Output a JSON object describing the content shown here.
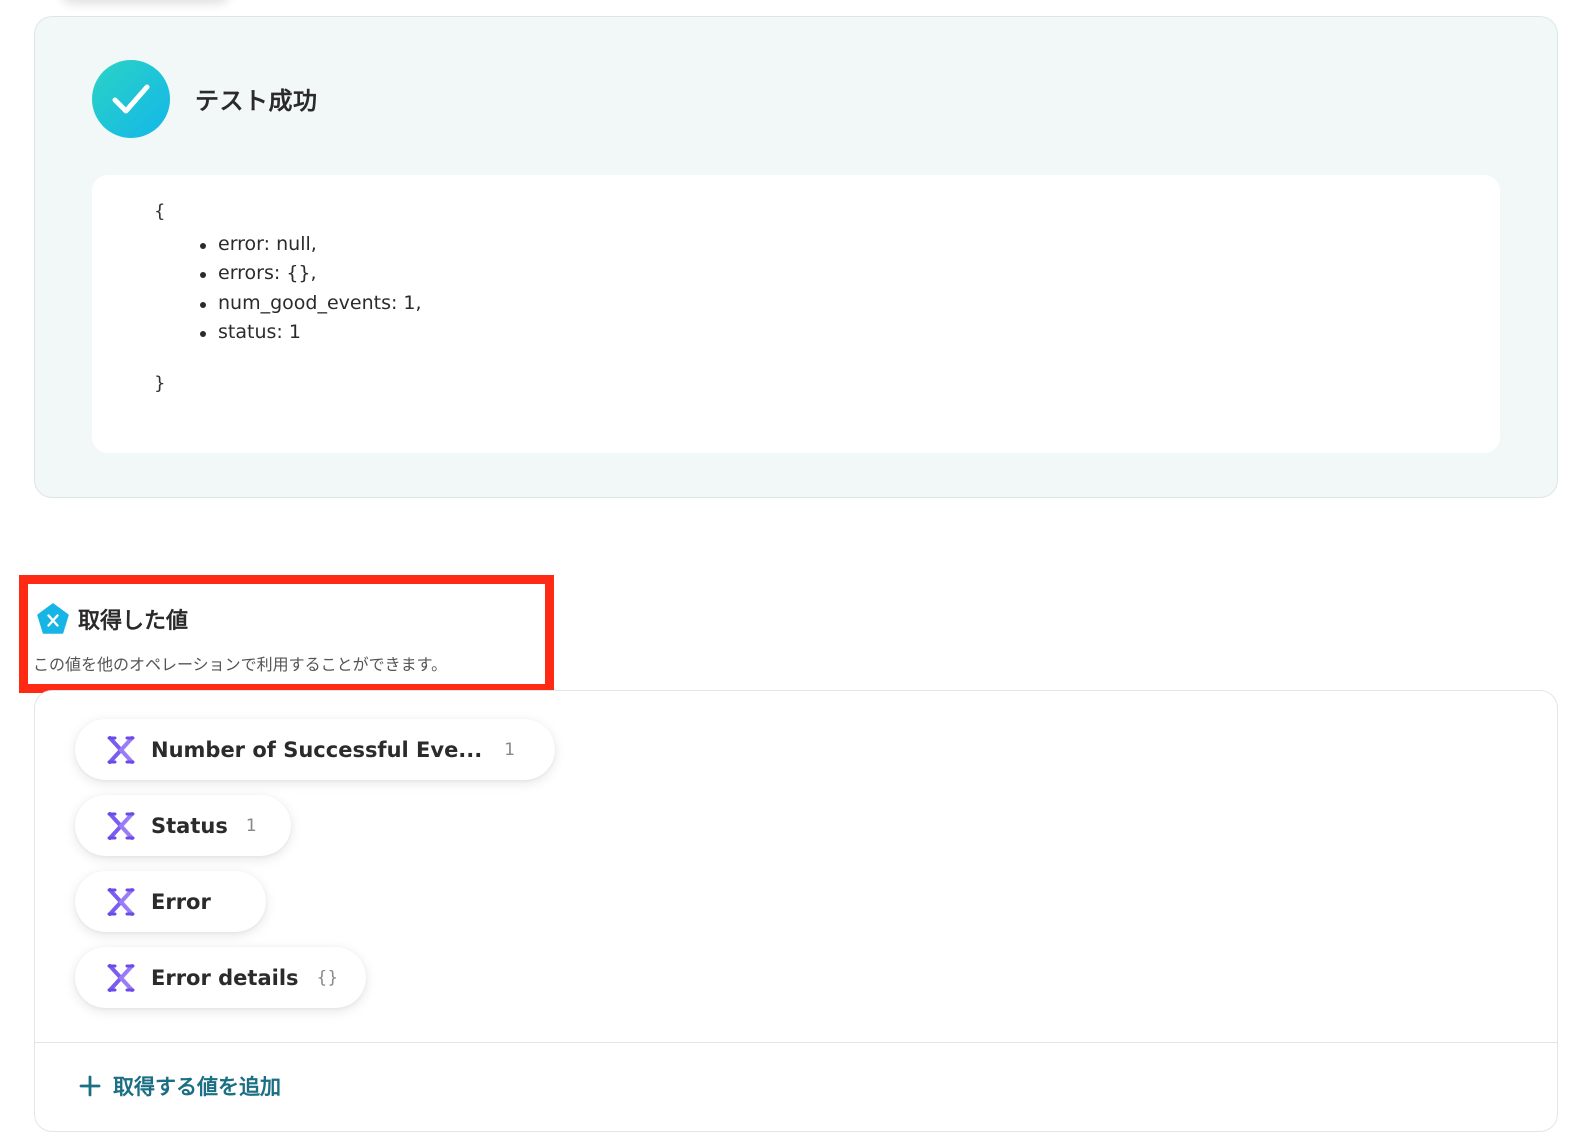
{
  "test_result": {
    "title": "テスト成功",
    "json": {
      "open": "{",
      "close": "}",
      "lines": [
        "error: null,",
        "errors: {},",
        "num_good_events: 1,",
        "status: 1"
      ]
    }
  },
  "obtained_values": {
    "title": "取得した値",
    "description": "この値を他のオペレーションで利用することができます。",
    "badge_icon": "variable-pentagon-icon",
    "items": [
      {
        "label": "Number of Successful Eve...",
        "value": "1",
        "icon": "variable-x-icon"
      },
      {
        "label": "Status",
        "value": "1",
        "icon": "variable-x-icon"
      },
      {
        "label": "Error",
        "value": "",
        "icon": "variable-x-icon"
      },
      {
        "label": "Error details",
        "value": "{}",
        "icon": "variable-x-icon"
      }
    ],
    "add_label": "取得する値を追加"
  },
  "colors": {
    "success_gradient_start": "#2cd3c4",
    "success_gradient_end": "#12b7e9",
    "highlight": "#ff2a14",
    "variable_icon": "#7b5cf0",
    "add_link": "#1b6f84"
  }
}
